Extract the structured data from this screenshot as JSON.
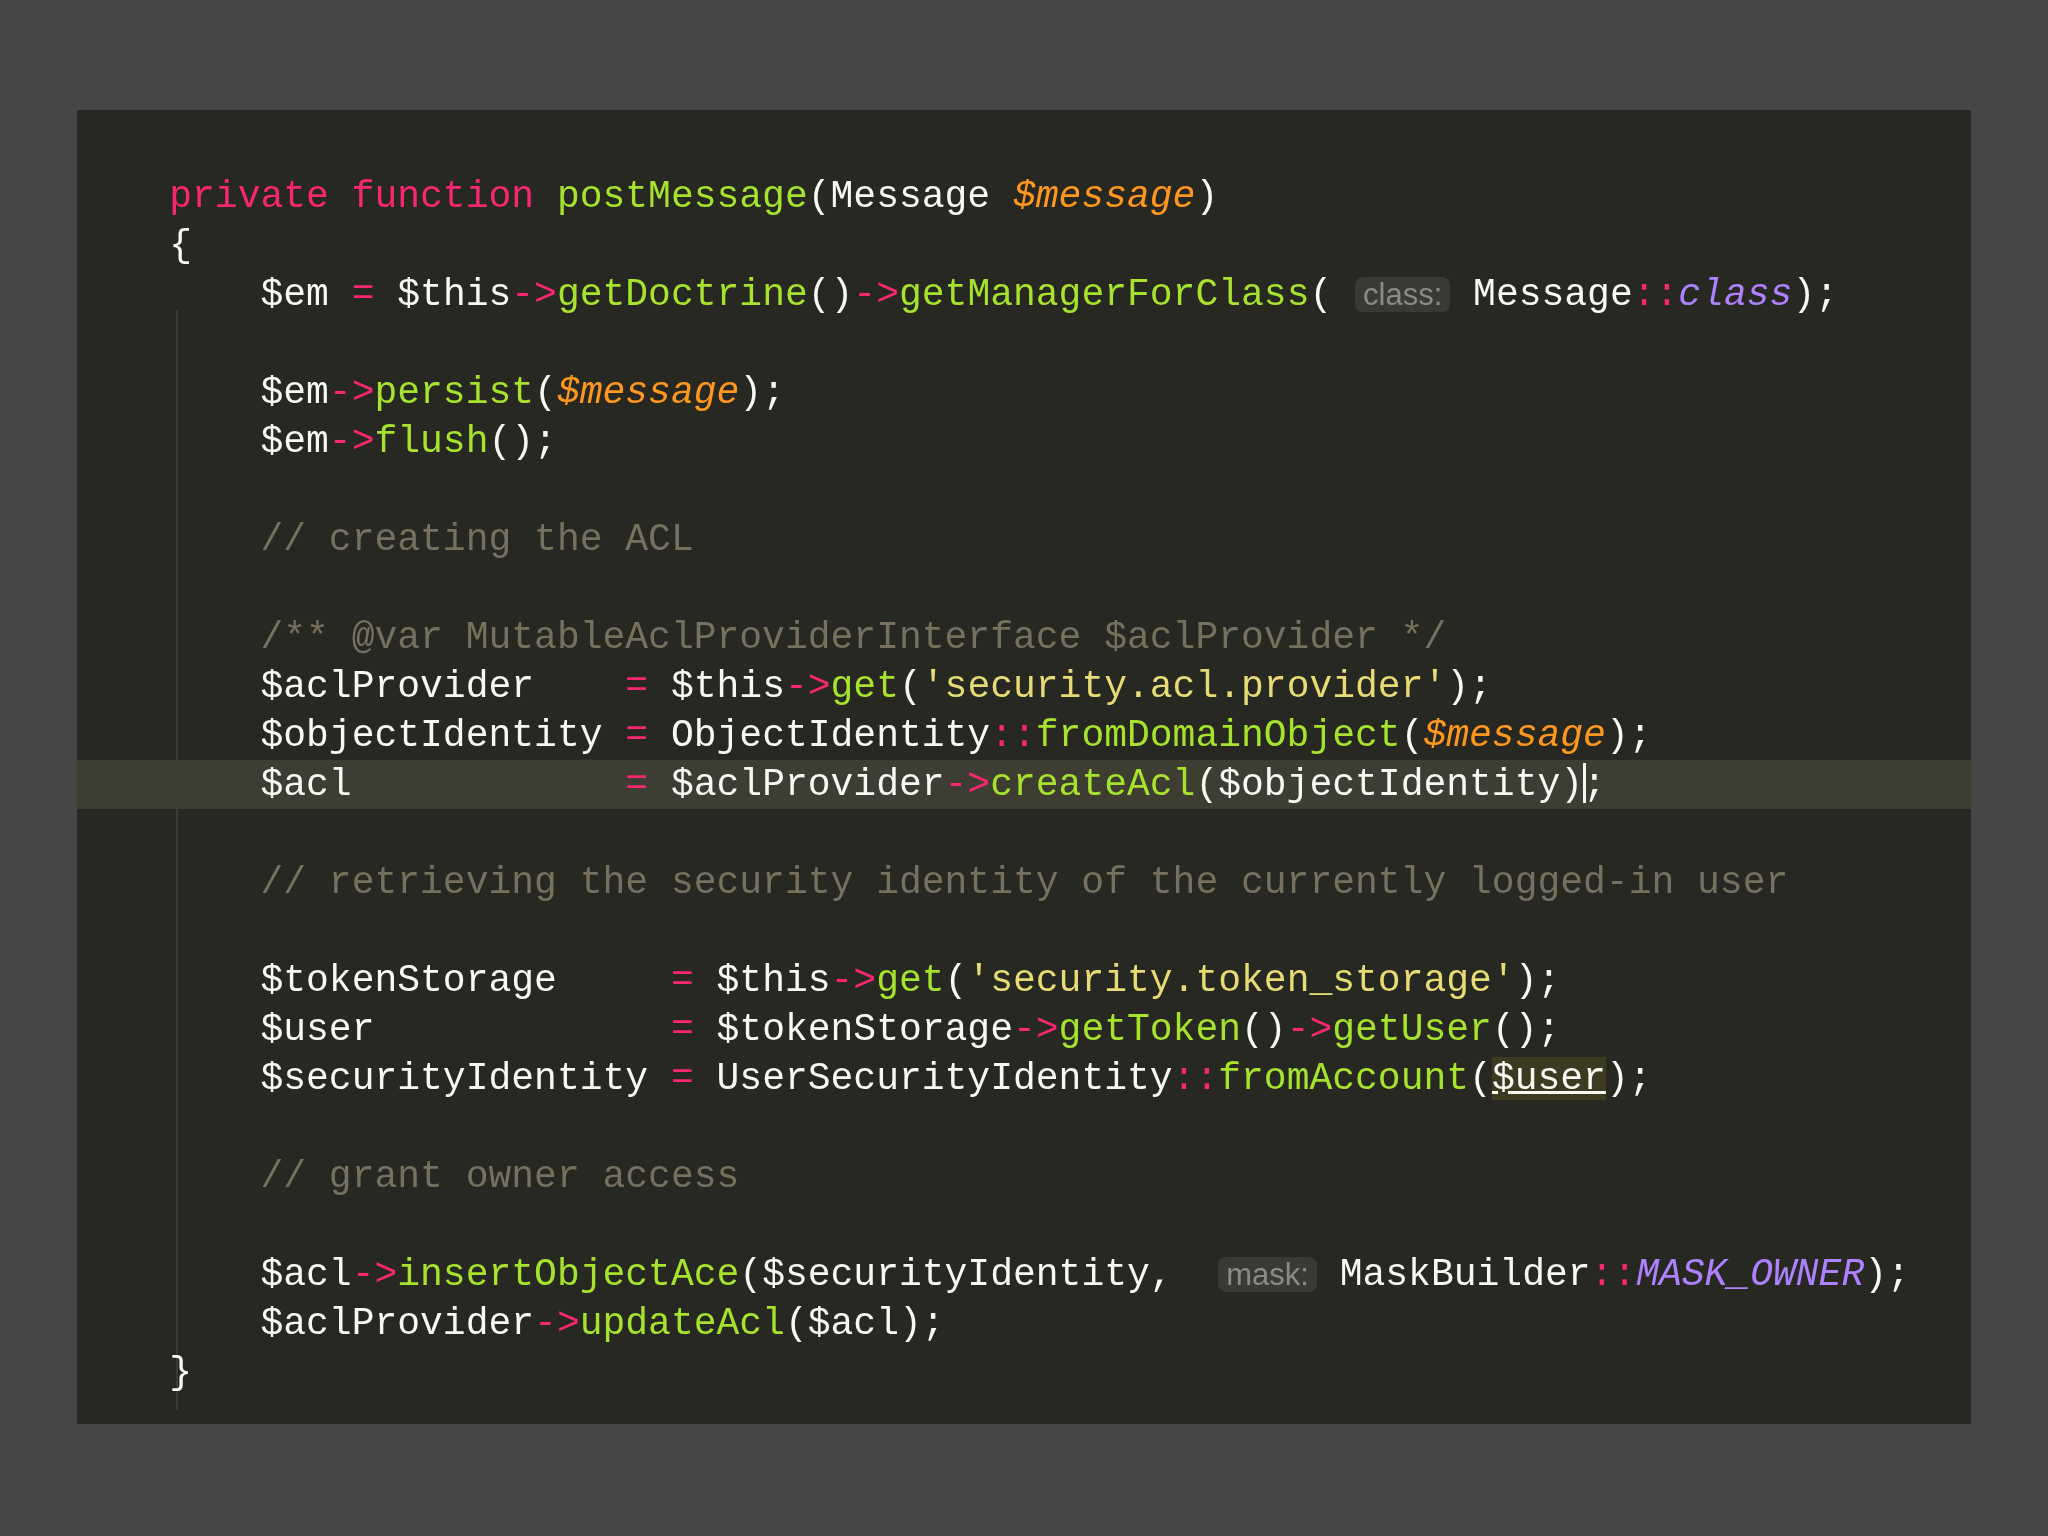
{
  "editor": {
    "lines": [
      {
        "highlighted": false
      },
      {
        "highlighted": false,
        "tokens": [
          {
            "kind": "keyword",
            "text": "    private function"
          },
          {
            "kind": "func",
            "text": " postMessage"
          },
          {
            "kind": "plain",
            "text": "(Message "
          },
          {
            "kind": "param",
            "text": "$message"
          },
          {
            "kind": "plain",
            "text": ")"
          }
        ]
      },
      {
        "highlighted": false,
        "tokens": [
          {
            "kind": "plain",
            "text": "    {"
          }
        ]
      },
      {
        "highlighted": false,
        "tokens": [
          {
            "kind": "plain",
            "text": "        $em "
          },
          {
            "kind": "op",
            "text": "="
          },
          {
            "kind": "plain",
            "text": " $this"
          },
          {
            "kind": "op",
            "text": "->"
          },
          {
            "kind": "func",
            "text": "getDoctrine"
          },
          {
            "kind": "plain",
            "text": "()"
          },
          {
            "kind": "op",
            "text": "->"
          },
          {
            "kind": "func",
            "text": "getManagerForClass"
          },
          {
            "kind": "plain",
            "text": "( "
          },
          {
            "kind": "hint",
            "text": "class:"
          },
          {
            "kind": "plain",
            "text": " Message"
          },
          {
            "kind": "op",
            "text": "::"
          },
          {
            "kind": "constant",
            "text": "class"
          },
          {
            "kind": "plain",
            "text": ");"
          }
        ]
      },
      {
        "highlighted": false
      },
      {
        "highlighted": false,
        "tokens": [
          {
            "kind": "plain",
            "text": "        $em"
          },
          {
            "kind": "op",
            "text": "->"
          },
          {
            "kind": "func",
            "text": "persist"
          },
          {
            "kind": "plain",
            "text": "("
          },
          {
            "kind": "param",
            "text": "$message"
          },
          {
            "kind": "plain",
            "text": ");"
          }
        ]
      },
      {
        "highlighted": false,
        "tokens": [
          {
            "kind": "plain",
            "text": "        $em"
          },
          {
            "kind": "op",
            "text": "->"
          },
          {
            "kind": "func",
            "text": "flush"
          },
          {
            "kind": "plain",
            "text": "();"
          }
        ]
      },
      {
        "highlighted": false
      },
      {
        "highlighted": false,
        "tokens": [
          {
            "kind": "comment",
            "text": "        // creating the ACL"
          }
        ]
      },
      {
        "highlighted": false
      },
      {
        "highlighted": false,
        "tokens": [
          {
            "kind": "comment",
            "text": "        /** @var MutableAclProviderInterface $aclProvider */"
          }
        ]
      },
      {
        "highlighted": false,
        "tokens": [
          {
            "kind": "plain",
            "text": "        $aclProvider    "
          },
          {
            "kind": "op",
            "text": "="
          },
          {
            "kind": "plain",
            "text": " $this"
          },
          {
            "kind": "op",
            "text": "->"
          },
          {
            "kind": "func",
            "text": "get"
          },
          {
            "kind": "plain",
            "text": "("
          },
          {
            "kind": "string",
            "text": "'security.acl.provider'"
          },
          {
            "kind": "plain",
            "text": ");"
          }
        ]
      },
      {
        "highlighted": false,
        "tokens": [
          {
            "kind": "plain",
            "text": "        $objectIdentity "
          },
          {
            "kind": "op",
            "text": "="
          },
          {
            "kind": "plain",
            "text": " ObjectIdentity"
          },
          {
            "kind": "op",
            "text": "::"
          },
          {
            "kind": "func",
            "text": "fromDomainObject"
          },
          {
            "kind": "plain",
            "text": "("
          },
          {
            "kind": "param",
            "text": "$message"
          },
          {
            "kind": "plain",
            "text": ");"
          }
        ]
      },
      {
        "highlighted": true,
        "tokens": [
          {
            "kind": "plain",
            "text": "        $acl            "
          },
          {
            "kind": "op",
            "text": "="
          },
          {
            "kind": "plain",
            "text": " $aclProvider"
          },
          {
            "kind": "op",
            "text": "->"
          },
          {
            "kind": "func",
            "text": "createAcl"
          },
          {
            "kind": "plain",
            "text": "($objectIdentity)"
          },
          {
            "kind": "cursor"
          },
          {
            "kind": "plain",
            "text": ";"
          }
        ]
      },
      {
        "highlighted": false
      },
      {
        "highlighted": false,
        "tokens": [
          {
            "kind": "comment",
            "text": "        // retrieving the security identity of the currently logged-in user"
          }
        ]
      },
      {
        "highlighted": false
      },
      {
        "highlighted": false,
        "tokens": [
          {
            "kind": "plain",
            "text": "        $tokenStorage     "
          },
          {
            "kind": "op",
            "text": "="
          },
          {
            "kind": "plain",
            "text": " $this"
          },
          {
            "kind": "op",
            "text": "->"
          },
          {
            "kind": "func",
            "text": "get"
          },
          {
            "kind": "plain",
            "text": "("
          },
          {
            "kind": "string",
            "text": "'security.token_storage'"
          },
          {
            "kind": "plain",
            "text": ");"
          }
        ]
      },
      {
        "highlighted": false,
        "tokens": [
          {
            "kind": "plain",
            "text": "        $user             "
          },
          {
            "kind": "op",
            "text": "="
          },
          {
            "kind": "plain",
            "text": " $tokenStorage"
          },
          {
            "kind": "op",
            "text": "->"
          },
          {
            "kind": "func",
            "text": "getToken"
          },
          {
            "kind": "plain",
            "text": "()"
          },
          {
            "kind": "op",
            "text": "->"
          },
          {
            "kind": "func",
            "text": "getUser"
          },
          {
            "kind": "plain",
            "text": "();"
          }
        ]
      },
      {
        "highlighted": false,
        "tokens": [
          {
            "kind": "plain",
            "text": "        $securityIdentity "
          },
          {
            "kind": "op",
            "text": "="
          },
          {
            "kind": "plain",
            "text": " UserSecurityIdentity"
          },
          {
            "kind": "op",
            "text": "::"
          },
          {
            "kind": "func",
            "text": "fromAccount"
          },
          {
            "kind": "plain",
            "text": "("
          },
          {
            "kind": "usage",
            "text": "$user"
          },
          {
            "kind": "plain",
            "text": ");"
          }
        ]
      },
      {
        "highlighted": false
      },
      {
        "highlighted": false,
        "tokens": [
          {
            "kind": "comment",
            "text": "        // grant owner access"
          }
        ]
      },
      {
        "highlighted": false
      },
      {
        "highlighted": false,
        "tokens": [
          {
            "kind": "plain",
            "text": "        $acl"
          },
          {
            "kind": "op",
            "text": "->"
          },
          {
            "kind": "func",
            "text": "insertObjectAce"
          },
          {
            "kind": "plain",
            "text": "($securityIdentity,  "
          },
          {
            "kind": "hint",
            "text": "mask:"
          },
          {
            "kind": "plain",
            "text": " MaskBuilder"
          },
          {
            "kind": "op",
            "text": "::"
          },
          {
            "kind": "constant",
            "text": "MASK_OWNER"
          },
          {
            "kind": "plain",
            "text": ");"
          }
        ]
      },
      {
        "highlighted": false,
        "tokens": [
          {
            "kind": "plain",
            "text": "        $aclProvider"
          },
          {
            "kind": "op",
            "text": "->"
          },
          {
            "kind": "func",
            "text": "updateAcl"
          },
          {
            "kind": "plain",
            "text": "($acl);"
          }
        ]
      },
      {
        "highlighted": false,
        "tokens": [
          {
            "kind": "plain",
            "text": "    }"
          }
        ]
      }
    ]
  }
}
